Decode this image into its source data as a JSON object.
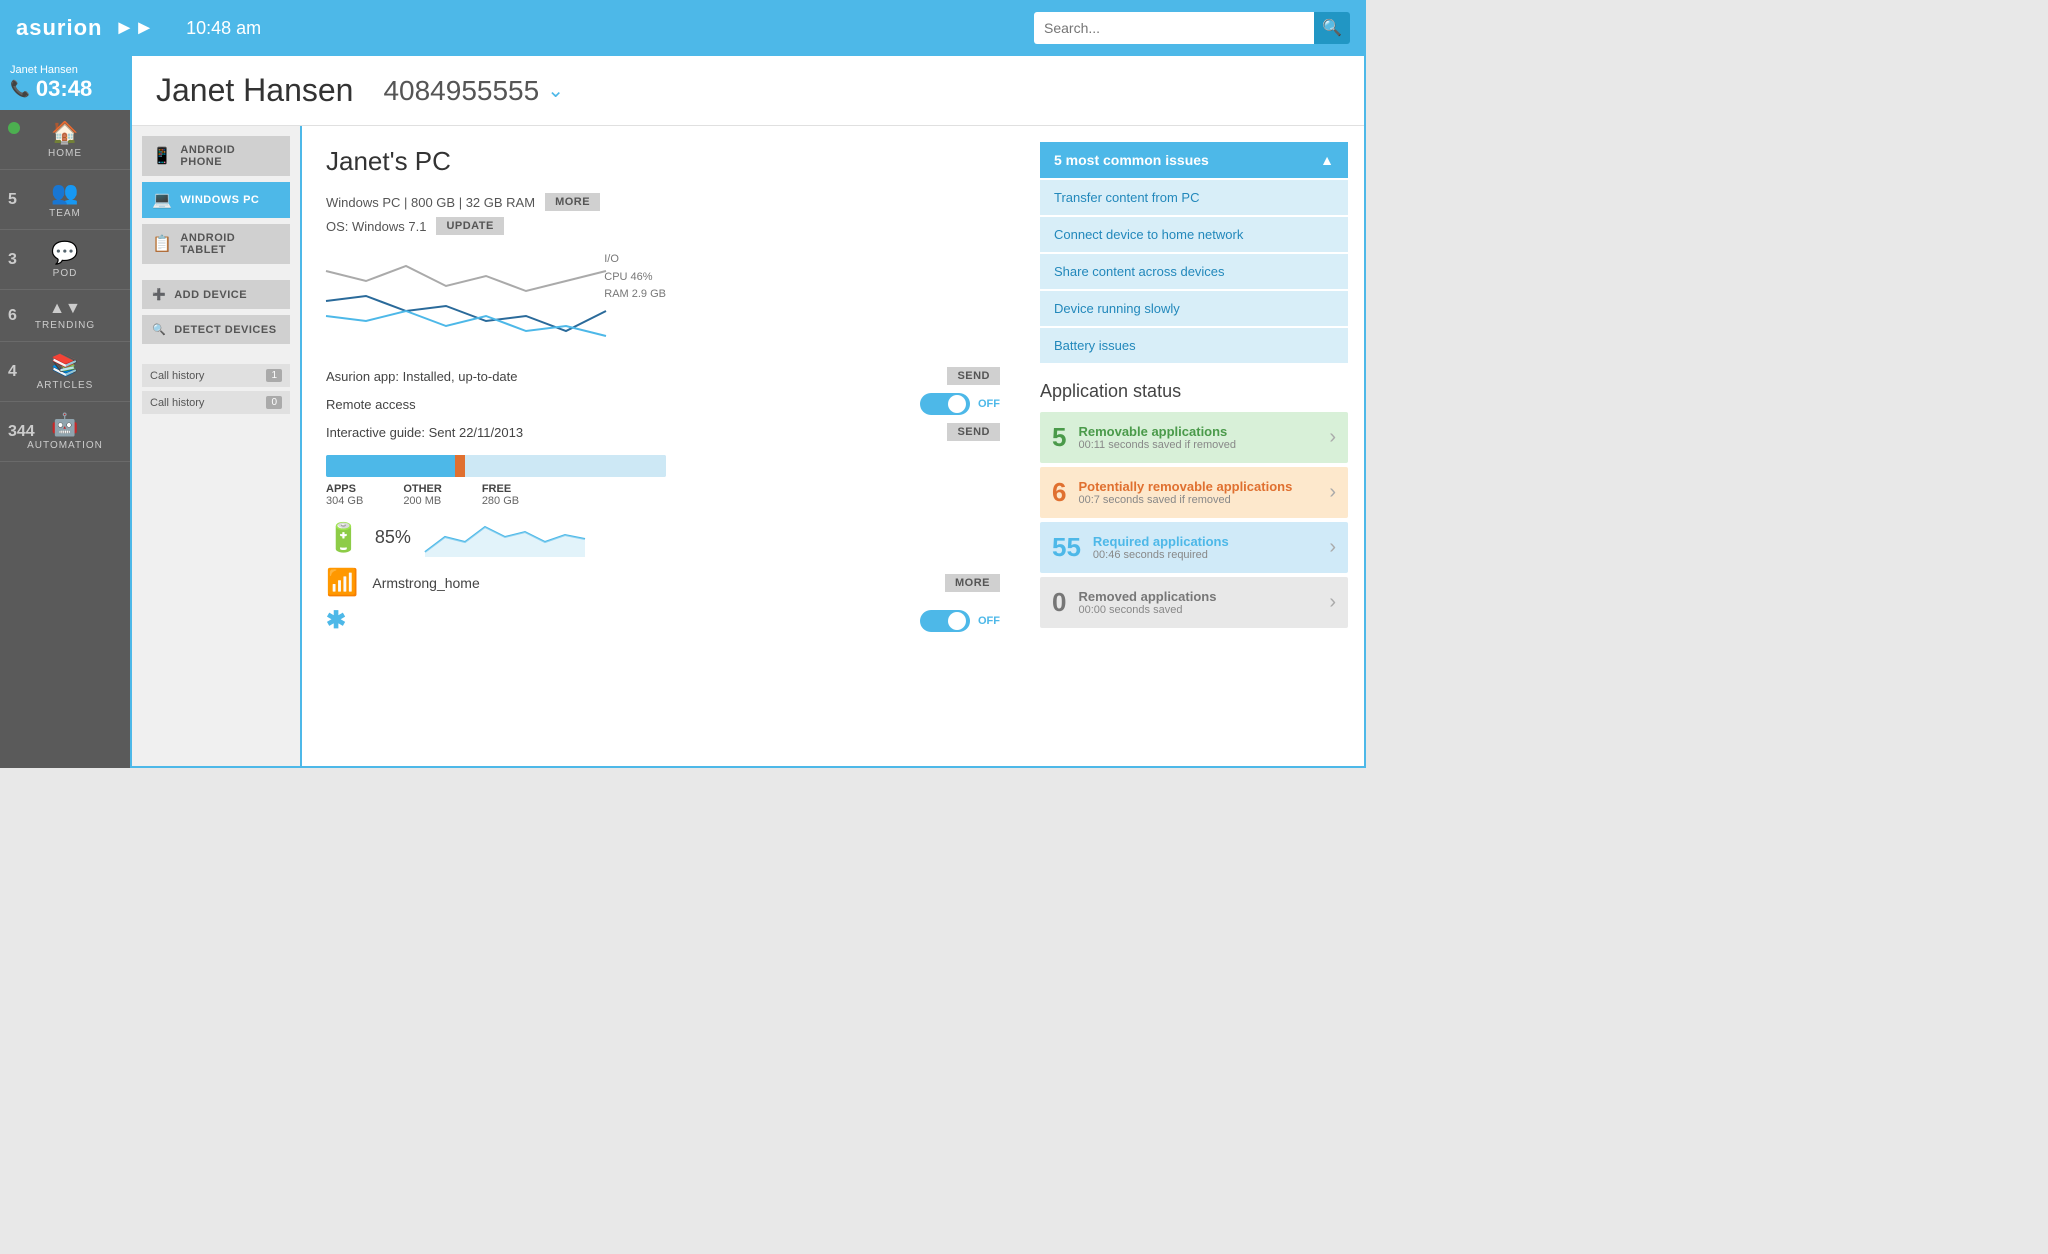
{
  "header": {
    "logo": "asurion",
    "time": "10:48 am",
    "search_placeholder": "Search..."
  },
  "sidebar": {
    "caller": {
      "name": "Janet Hansen",
      "timer": "03:48"
    },
    "nav_items": [
      {
        "id": "home",
        "label": "HOME",
        "icon": "🏠",
        "badge": null,
        "dot": true
      },
      {
        "id": "team",
        "label": "TEAM",
        "icon": "👥",
        "badge": "5",
        "dot": false
      },
      {
        "id": "pod",
        "label": "POD",
        "icon": "💬",
        "badge": "3",
        "dot": false
      },
      {
        "id": "trending",
        "label": "TRENDING",
        "icon": "▲▼",
        "badge": "6",
        "dot": false
      },
      {
        "id": "articles",
        "label": "ARTICLES",
        "icon": "📚",
        "badge": "4",
        "dot": false
      },
      {
        "id": "automation",
        "label": "AUTOMATION",
        "icon": "🤖",
        "badge": "344",
        "dot": false
      }
    ]
  },
  "patient": {
    "name": "Janet Hansen",
    "phone": "4084955555"
  },
  "devices": [
    {
      "id": "android-phone",
      "label": "ANDROID PHONE",
      "icon": "📱",
      "active": false
    },
    {
      "id": "windows-pc",
      "label": "WINDOWS PC",
      "icon": "💻",
      "active": true
    },
    {
      "id": "android-tablet",
      "label": "ANDROID TABLET",
      "icon": "📋",
      "active": false
    }
  ],
  "device_actions": [
    {
      "id": "add-device",
      "label": "ADD DEVICE",
      "icon": "➕"
    },
    {
      "id": "detect-devices",
      "label": "DETECT DEVICES",
      "icon": "🔍"
    }
  ],
  "call_history": [
    {
      "label": "Call history",
      "count": "1"
    },
    {
      "label": "Call history",
      "count": "0"
    }
  ],
  "device_info": {
    "title": "Janet's PC",
    "specs": "Windows PC | 800 GB | 32 GB RAM",
    "more_label": "MORE",
    "os": "OS: Windows 7.1",
    "update_label": "UPDATE",
    "app_label": "Asurion app: Installed, up-to-date",
    "send_label": "SEND",
    "remote_access": "Remote access",
    "remote_toggle": "OFF",
    "guide": "Interactive guide: Sent 22/11/2013",
    "guide_send": "SEND",
    "storage": {
      "apps_label": "APPS",
      "apps_value": "304 GB",
      "other_label": "OTHER",
      "other_value": "200 MB",
      "free_label": "FREE",
      "free_value": "280 GB",
      "apps_pct": 38,
      "other_pct": 3,
      "free_pct": 59
    },
    "battery": {
      "percent": "85%"
    },
    "wifi": {
      "name": "Armstrong_home",
      "more_label": "MORE"
    },
    "bluetooth": {
      "toggle": "OFF"
    }
  },
  "issues": {
    "header": "5 most common issues",
    "items": [
      "Transfer content from PC",
      "Connect device to home network",
      "Share content across devices",
      "Device running slowly",
      "Battery issues"
    ]
  },
  "application_status": {
    "title": "Application status",
    "items": [
      {
        "count": "5",
        "color": "green",
        "label": "Removable applications",
        "sublabel": "00:11 seconds saved if removed"
      },
      {
        "count": "6",
        "color": "orange",
        "label": "Potentially removable applications",
        "sublabel": "00:7 seconds saved if removed"
      },
      {
        "count": "55",
        "color": "blue",
        "label": "Required applications",
        "sublabel": "00:46 seconds required"
      },
      {
        "count": "0",
        "color": "gray",
        "label": "Removed applications",
        "sublabel": "00:00 seconds saved"
      }
    ]
  }
}
